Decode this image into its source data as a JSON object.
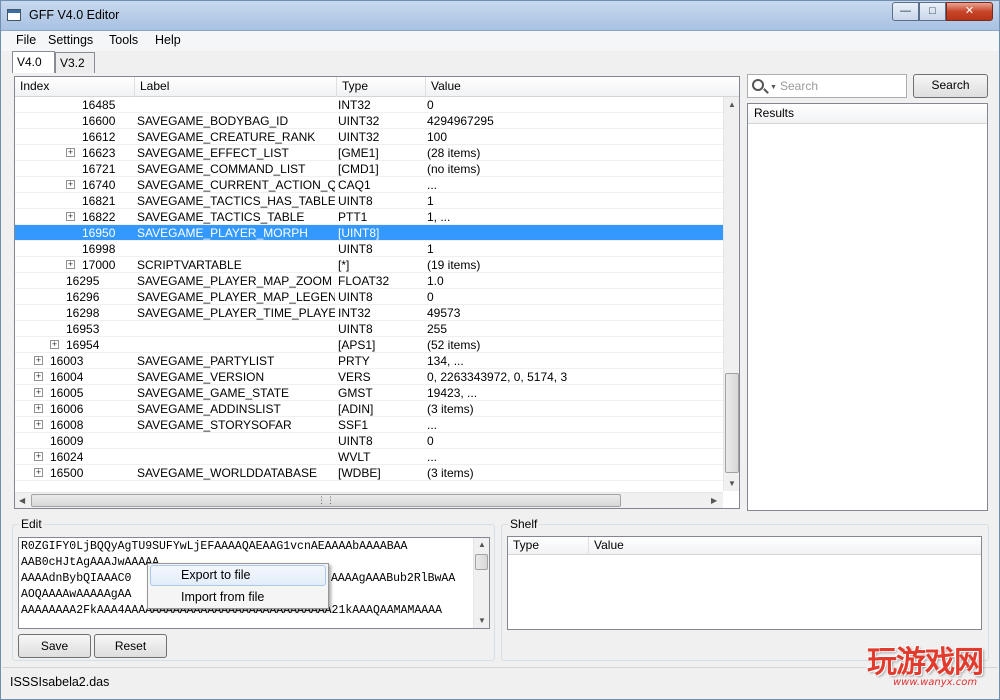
{
  "window": {
    "title": "GFF V4.0 Editor"
  },
  "menu": [
    "File",
    "Settings",
    "Tools",
    "Help"
  ],
  "tabs": [
    "V4.0",
    "V3.2"
  ],
  "tree": {
    "columns": [
      "Index",
      "Label",
      "Type",
      "Value"
    ],
    "rows": [
      {
        "indent": 3,
        "expander": false,
        "index": "16485",
        "label": "",
        "type": "INT32",
        "value": "0"
      },
      {
        "indent": 3,
        "expander": false,
        "index": "16600",
        "label": "SAVEGAME_BODYBAG_ID",
        "type": "UINT32",
        "value": "4294967295"
      },
      {
        "indent": 3,
        "expander": false,
        "index": "16612",
        "label": "SAVEGAME_CREATURE_RANK",
        "type": "UINT32",
        "value": "100"
      },
      {
        "indent": 3,
        "expander": true,
        "index": "16623",
        "label": "SAVEGAME_EFFECT_LIST",
        "type": "[GME1]",
        "value": "(28 items)"
      },
      {
        "indent": 3,
        "expander": false,
        "index": "16721",
        "label": "SAVEGAME_COMMAND_LIST",
        "type": "[CMD1]",
        "value": "(no items)"
      },
      {
        "indent": 3,
        "expander": true,
        "index": "16740",
        "label": "SAVEGAME_CURRENT_ACTION_QUI",
        "type": "CAQ1",
        "value": "..."
      },
      {
        "indent": 3,
        "expander": false,
        "index": "16821",
        "label": "SAVEGAME_TACTICS_HAS_TABLE",
        "type": "UINT8",
        "value": "1"
      },
      {
        "indent": 3,
        "expander": true,
        "index": "16822",
        "label": "SAVEGAME_TACTICS_TABLE",
        "type": "PTT1",
        "value": "1, ..."
      },
      {
        "indent": 3,
        "expander": false,
        "index": "16950",
        "label": "SAVEGAME_PLAYER_MORPH",
        "type": "[UINT8]",
        "value": "",
        "selected": true
      },
      {
        "indent": 3,
        "expander": false,
        "index": "16998",
        "label": "",
        "type": "UINT8",
        "value": "1"
      },
      {
        "indent": 3,
        "expander": true,
        "index": "17000",
        "label": "SCRIPTVARTABLE",
        "type": "[*]",
        "value": "(19 items)"
      },
      {
        "indent": 2,
        "expander": false,
        "index": "16295",
        "label": "SAVEGAME_PLAYER_MAP_ZOOM",
        "type": "FLOAT32",
        "value": "1.0"
      },
      {
        "indent": 2,
        "expander": false,
        "index": "16296",
        "label": "SAVEGAME_PLAYER_MAP_LEGEND",
        "type": "UINT8",
        "value": "0"
      },
      {
        "indent": 2,
        "expander": false,
        "index": "16298",
        "label": "SAVEGAME_PLAYER_TIME_PLAYED",
        "type": "INT32",
        "value": "49573"
      },
      {
        "indent": 2,
        "expander": false,
        "index": "16953",
        "label": "",
        "type": "UINT8",
        "value": "255"
      },
      {
        "indent": 2,
        "expander": true,
        "index": "16954",
        "label": "",
        "type": "[APS1]",
        "value": "(52 items)"
      },
      {
        "indent": 1,
        "expander": true,
        "index": "16003",
        "label": "SAVEGAME_PARTYLIST",
        "type": "PRTY",
        "value": "134, ..."
      },
      {
        "indent": 1,
        "expander": true,
        "index": "16004",
        "label": "SAVEGAME_VERSION",
        "type": "VERS",
        "value": "0, 2263343972, 0, 5174, 3"
      },
      {
        "indent": 1,
        "expander": true,
        "index": "16005",
        "label": "SAVEGAME_GAME_STATE",
        "type": "GMST",
        "value": "19423, ..."
      },
      {
        "indent": 1,
        "expander": true,
        "index": "16006",
        "label": "SAVEGAME_ADDINSLIST",
        "type": "[ADIN]",
        "value": "(3 items)"
      },
      {
        "indent": 1,
        "expander": true,
        "index": "16008",
        "label": "SAVEGAME_STORYSOFAR",
        "type": "SSF1",
        "value": "..."
      },
      {
        "indent": 1,
        "expander": false,
        "index": "16009",
        "label": "",
        "type": "UINT8",
        "value": "0"
      },
      {
        "indent": 1,
        "expander": true,
        "index": "16024",
        "label": "",
        "type": "WVLT",
        "value": "..."
      },
      {
        "indent": 1,
        "expander": true,
        "index": "16500",
        "label": "SAVEGAME_WORLDDATABASE",
        "type": "[WDBE]",
        "value": "(3 items)"
      }
    ]
  },
  "search": {
    "placeholder": "Search",
    "button_label": "Search"
  },
  "results": {
    "header": "Results"
  },
  "edit": {
    "group_label": "Edit",
    "lines": [
      "R0ZGIFY0LjBQQyAgTU9SUFYwLjEFAAAAQAEAAG1vcnAEAAAAbAAAABAA",
      "AAB0cHJtAgAAAJwAAAAA",
      "AAAAdnBybQIAAAC0",
      "AOQAAAAwAAAAAgAA",
      "AAAAAAAA2FkAAA4AAAAAAAAAAAAAAAAAAAAAAAAAAAAAA21kAAAQAAMAMAAAA"
    ],
    "line3_right": "AAAAgAAABub2RlBwAA",
    "save_label": "Save",
    "reset_label": "Reset"
  },
  "context_menu": {
    "items": [
      "Export to file",
      "Import from file"
    ]
  },
  "shelf": {
    "group_label": "Shelf",
    "columns": [
      "Type",
      "Value"
    ]
  },
  "status": {
    "file": "ISSSIsabela2.das"
  },
  "watermark": {
    "main": "玩游戏网",
    "sub": "www.wanyx.com"
  }
}
